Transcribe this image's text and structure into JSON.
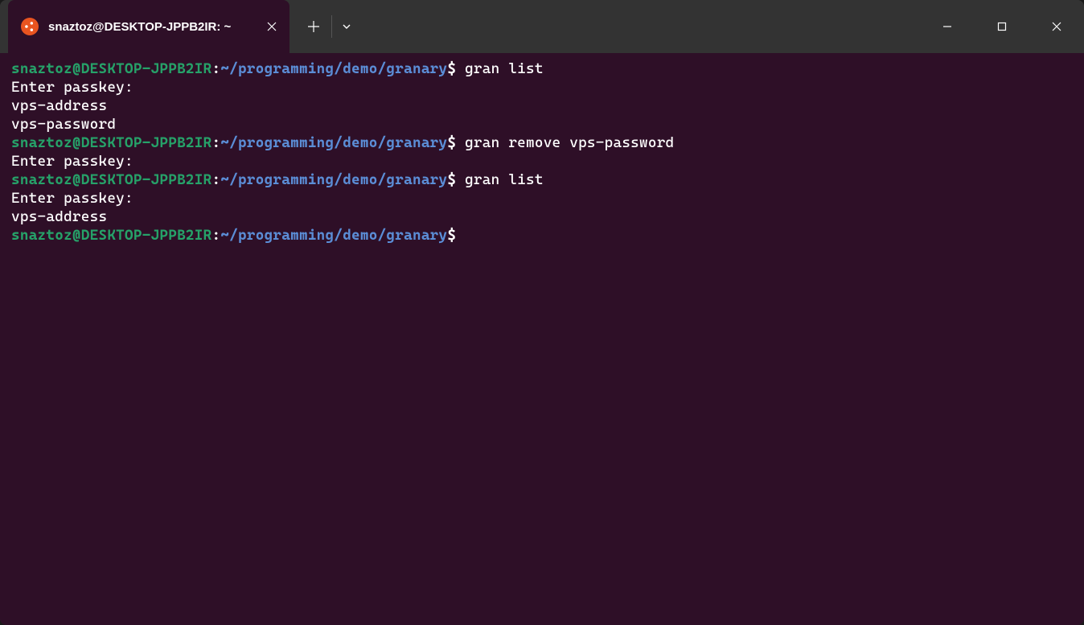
{
  "titlebar": {
    "tab": {
      "title": "snaztoz@DESKTOP-JPPB2IR: ~"
    }
  },
  "terminal": {
    "prompt_user_host": "snaztoz@DESKTOP-JPPB2IR",
    "prompt_colon": ":",
    "prompt_path": "~/programming/demo/granary",
    "prompt_dollar": "$",
    "lines": [
      {
        "type": "prompt",
        "cmd": " gran list"
      },
      {
        "type": "output",
        "text": "Enter passkey:"
      },
      {
        "type": "output",
        "text": "vps-address"
      },
      {
        "type": "output",
        "text": "vps-password"
      },
      {
        "type": "prompt",
        "cmd": " gran remove vps-password"
      },
      {
        "type": "output",
        "text": "Enter passkey:"
      },
      {
        "type": "prompt",
        "cmd": " gran list"
      },
      {
        "type": "output",
        "text": "Enter passkey:"
      },
      {
        "type": "output",
        "text": "vps-address"
      },
      {
        "type": "prompt",
        "cmd": ""
      }
    ]
  }
}
